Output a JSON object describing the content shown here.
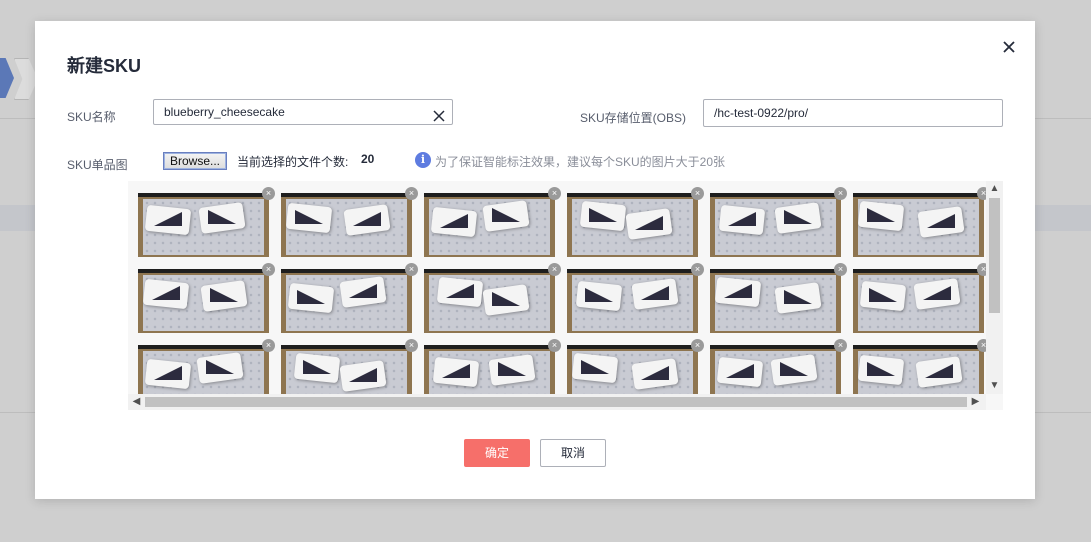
{
  "dialog": {
    "title": "新建SKU",
    "sku_name_label": "SKU名称",
    "sku_name_value": "blueberry_cheesecake",
    "obs_label": "SKU存储位置(OBS)",
    "obs_value": "/hc-test-0922/pro/",
    "image_label": "SKU单品图",
    "browse_label": "Browse...",
    "file_count_label": "当前选择的文件个数:",
    "file_count": "20",
    "hint": "为了保证智能标注效果，建议每个SKU的图片大于20张",
    "info_icon": "info-icon",
    "ok_label": "确定",
    "cancel_label": "取消"
  },
  "icons": {
    "close": "close-icon",
    "clear": "clear-icon",
    "delete_thumb": "remove-image-icon"
  },
  "gallery": {
    "visible_images": 18,
    "columns": 6
  },
  "colors": {
    "primary_button": "#f66f6a",
    "info": "#5e7ce0",
    "title": "#252b3a",
    "overlay_bg": "#cfcfcf"
  }
}
